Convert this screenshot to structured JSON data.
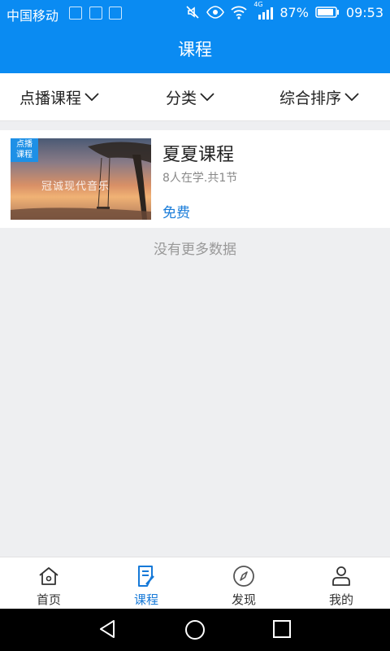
{
  "status": {
    "carrier": "中国移动",
    "network": "4G",
    "battery": "87%",
    "time": "09:53"
  },
  "header": {
    "title": "课程"
  },
  "filters": [
    {
      "label": "点播课程"
    },
    {
      "label": "分类"
    },
    {
      "label": "综合排序"
    }
  ],
  "courses": [
    {
      "badge": "点播\n课程",
      "thumb_caption": "冠诚现代音乐",
      "title": "夏夏课程",
      "meta": "8人在学.共1节",
      "price": "免费"
    }
  ],
  "footer_note": "没有更多数据",
  "tabs": [
    {
      "label": "首页",
      "icon": "home-icon"
    },
    {
      "label": "课程",
      "icon": "course-icon",
      "active": true
    },
    {
      "label": "发现",
      "icon": "compass-icon"
    },
    {
      "label": "我的",
      "icon": "user-icon"
    }
  ],
  "colors": {
    "primary": "#0a8bf2",
    "active_tab": "#1679d8",
    "price": "#1b7dd9"
  }
}
